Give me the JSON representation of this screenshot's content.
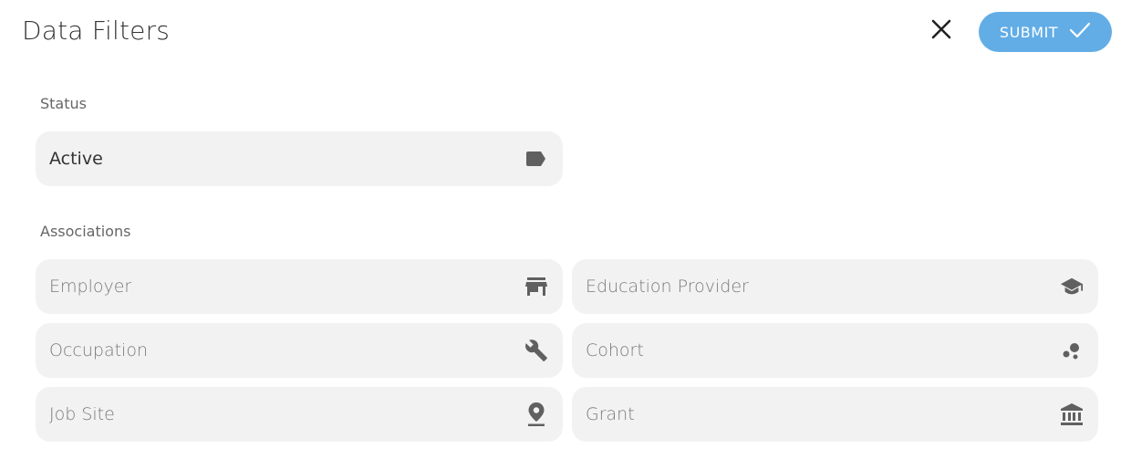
{
  "header": {
    "title": "Data Filters",
    "submit_label": "SUBMIT"
  },
  "colors": {
    "accent": "#62ade6",
    "field_bg": "#f2f2f2",
    "icon": "#606060"
  },
  "status": {
    "label": "Status",
    "field": {
      "value": "Active",
      "icon": "label-icon"
    }
  },
  "associations": {
    "label": "Associations",
    "fields": [
      {
        "placeholder": "Employer",
        "icon": "store-icon"
      },
      {
        "placeholder": "Education Provider",
        "icon": "school-icon"
      },
      {
        "placeholder": "Occupation",
        "icon": "wrench-icon"
      },
      {
        "placeholder": "Cohort",
        "icon": "bubbles-icon"
      },
      {
        "placeholder": "Job Site",
        "icon": "location-pin-icon"
      },
      {
        "placeholder": "Grant",
        "icon": "bank-icon"
      }
    ]
  }
}
